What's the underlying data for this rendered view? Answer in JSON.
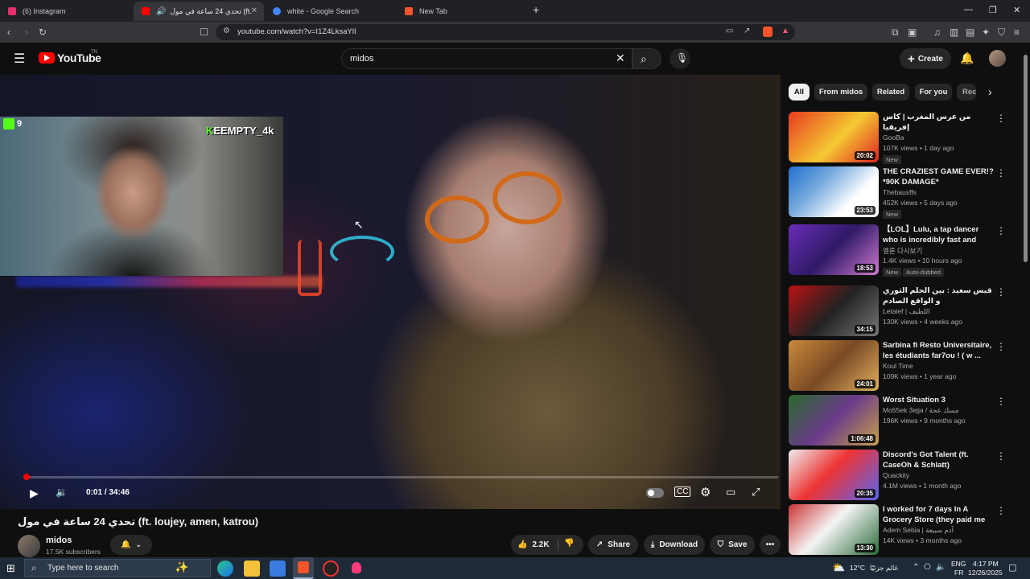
{
  "browser": {
    "tabs": [
      {
        "label": "(6) Instagram",
        "color": "#e1306c"
      },
      {
        "label": "تحدي 24 ساعة في مول (ft. loujey, amen, katrou)",
        "color": "#ff0000"
      },
      {
        "label": "white - Google Search",
        "color": "#4285f4"
      },
      {
        "label": "New Tab",
        "color": "#fb542b"
      }
    ],
    "url": "youtube.com/watch?v=I1Z4LksaYlI",
    "window_controls": {
      "minimize": "—",
      "restore": "❐",
      "close": "✕"
    }
  },
  "youtube": {
    "logo_text": "YouTube",
    "logo_sup": "TN",
    "search_value": "midos",
    "create_label": "Create"
  },
  "player": {
    "webcam_name_prefix": "K",
    "webcam_name": "EEMPTY_4k",
    "viewer_count": "9",
    "time": "0:01 / 34:46",
    "progress": 0.0005
  },
  "video": {
    "title": "تحدي 24 ساعة في مول (ft. loujey, amen, katrou)",
    "channel": "midos",
    "subscribers": "17.5K subscribers",
    "likes": "2.2K",
    "share_label": "Share",
    "download_label": "Download",
    "save_label": "Save"
  },
  "chips": [
    "All",
    "From midos",
    "Related",
    "For you",
    "Rec"
  ],
  "recommendations": [
    {
      "title": "من عرس المغرب | كاس إفريقيا",
      "channel": "GooBa",
      "meta": "107K views • 1 day ago",
      "badge": "New",
      "duration": "20:02",
      "thumb": "linear-gradient(135deg,#e63b1f,#f6c933 55%,#d22)"
    },
    {
      "title": "THE CRAZIEST GAME EVER!? *90K DAMAGE*",
      "channel": "Thebausffs",
      "meta": "452K views • 5 days ago",
      "badge": "New",
      "duration": "23:53",
      "thumb": "linear-gradient(135deg,#1f6fd0,#7ad,#fff 70%)"
    },
    {
      "title": "【LOL】Lulu, a tap dancer who is incredibly fast and different ...",
      "channel": "멜론 다시보기",
      "meta": "1.4K views • 10 hours ago",
      "badge": "New",
      "badge2": "Auto-dubbed",
      "duration": "18:53",
      "thumb": "linear-gradient(135deg,#6a2cb8,#2e1a66,#d27ad0)"
    },
    {
      "title": "قيس سعيد : بين الحلم الثوري و الواقع الصادم",
      "channel": "Letaief | اللطيف",
      "meta": "130K views • 4 weeks ago",
      "duration": "34:15",
      "thumb": "linear-gradient(135deg,#b11,#222 50%,#777)"
    },
    {
      "title": "Sarbina fi Resto Universitaire, les étudiants far7ou ! ( w ...",
      "channel": "Koul Time",
      "meta": "109K views • 1 year ago",
      "duration": "24:01",
      "thumb": "linear-gradient(135deg,#c98a3a,#7a4a24,#e0b060)"
    },
    {
      "title": "Worst Situation 3",
      "channel": "Mo55ek 3ejja / مسك عجة",
      "meta": "196K views • 9 months ago",
      "duration": "1:06:48",
      "thumb": "linear-gradient(135deg,#2a6a2a,#6a3a8a,#c8a048)"
    },
    {
      "title": "Discord's Got Talent (ft. CaseOh & Schlatt)",
      "channel": "Quackity",
      "meta": "4.1M views • 1 month ago",
      "duration": "20:35",
      "thumb": "linear-gradient(135deg,#eee,#e33 45%,#5865f2)"
    },
    {
      "title": "I worked for 7 days In A Grocery Store (they paid me💷)",
      "channel": "Adem Sebia | آدم سبيعة",
      "meta": "14K views • 3 months ago",
      "duration": "13:30",
      "thumb": "linear-gradient(135deg,#c33,#f5f5f5 45%,#2a6a3a)"
    }
  ],
  "taskbar": {
    "search_placeholder": "Type here to search",
    "weather": "12°C",
    "weather_text": "غائم جزئيًا",
    "lang_top": "ENG",
    "lang_bottom": "FR",
    "time": "4:17 PM",
    "date": "12/26/2025"
  },
  "colors": {
    "accent": "#ff0000",
    "bg": "#0f0f0f",
    "chip": "#272727"
  }
}
